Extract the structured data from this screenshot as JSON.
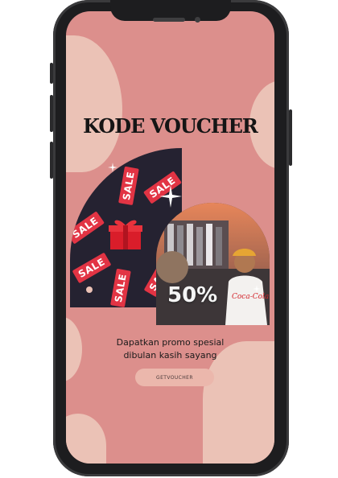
{
  "colors": {
    "screen_bg": "#dc8f8c",
    "blob": "#ebc2b6",
    "panel_dark": "#252231",
    "sale_red": "#e23444",
    "button_bg": "#ebb7ac"
  },
  "promo": {
    "title": "KODE VOUCHER",
    "description_line1": "Dapatkan promo spesial",
    "description_line2": "dibulan kasih sayang",
    "button_label": "GETVOUCHER"
  },
  "sale_tags": [
    "SALE",
    "SALE",
    "SALE",
    "SALE",
    "SALE",
    "SALE"
  ],
  "photo": {
    "discount_text": "50%",
    "shirt_brand": "Coca-Cola"
  },
  "icons": {
    "gift": "gift-icon",
    "sparkle": "sparkle-icon"
  }
}
